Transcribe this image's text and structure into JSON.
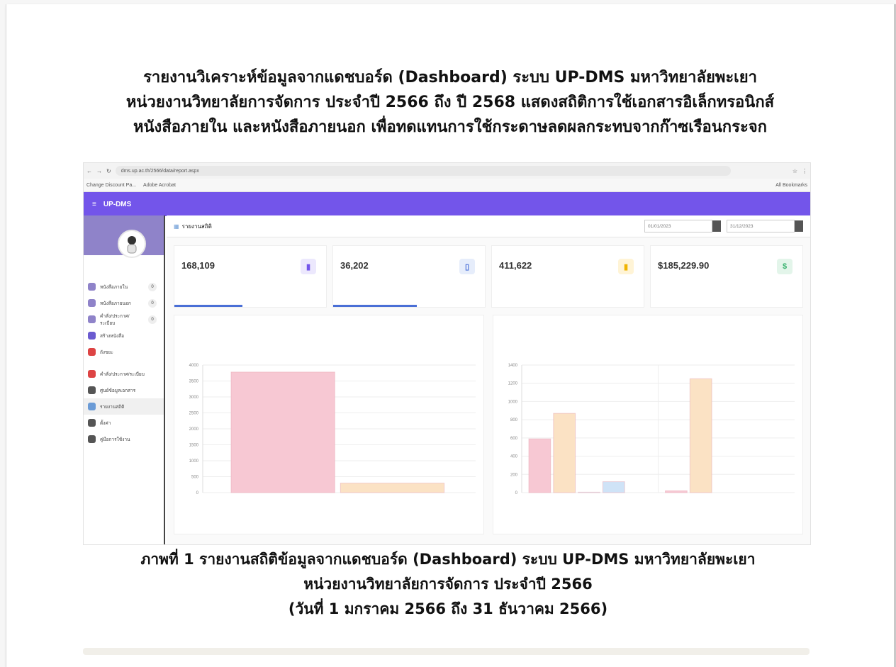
{
  "report": {
    "heading_lines": [
      "รายงานวิเคราะห์ข้อมูลจากแดชบอร์ด (Dashboard) ระบบ UP-DMS มหาวิทยาลัยพะเยา",
      "หน่วยงานวิทยาลัยการจัดการ ประจำปี 2566 ถึง ปี 2568 แสดงสถิติการใช้เอกสารอิเล็กทรอนิกส์",
      "หนังสือภายใน และหนังสือภายนอก เพื่อทดแทนการใช้กระดาษลดผลกระทบจากก๊าซเรือนกระจก"
    ],
    "caption_lines": [
      "ภาพที่ 1 รายงานสถิติข้อมูลจากแดชบอร์ด (Dashboard) ระบบ UP-DMS มหาวิทยาลัยพะเยา",
      "หน่วยงานวิทยาลัยการจัดการ ประจำปี 2566",
      "(วันที่ 1 มกราคม 2566 ถึง 31 ธันวาคม 2566)"
    ]
  },
  "browser": {
    "url": "dms.up.ac.th/2566/data/report.aspx",
    "bookmarks": [
      "Change Discount Pa...",
      "Adobe Acrobat"
    ],
    "all_bookmarks": "All Bookmarks"
  },
  "app": {
    "name": "UP-DMS",
    "page_title": "รายงานสถิติ",
    "date_from": "01/01/2023",
    "date_to": "31/12/2023",
    "sidebar": [
      "หนังสือภายใน",
      "หนังสือภายนอก",
      "คำสั่ง/ประกาศ/ระเบียบ",
      "สร้างหนังสือ",
      "ถังขยะ",
      "คำสั่ง/ประกาศ/ระเบียบ",
      "ศูนย์ข้อมูลเอกสาร",
      "รายงานสถิติ",
      "ตั้งค่า",
      "คู่มือการใช้งาน"
    ]
  },
  "cards": [
    {
      "value": "168,109",
      "color": "#7355ea",
      "icon": "document-icon",
      "bar": 0.45
    },
    {
      "value": "36,202",
      "color": "#4a6fd6",
      "icon": "file-icon",
      "bar": 0.55
    },
    {
      "value": "411,622",
      "color": "#f0b400",
      "icon": "folder-icon",
      "bar": 0
    },
    {
      "value": "$185,229.90",
      "color": "#3cb371",
      "icon": "dollar-icon",
      "bar": 0
    }
  ],
  "chart_data": [
    {
      "type": "bar",
      "ylim": [
        0,
        4000
      ],
      "yticks": [
        0,
        500,
        1000,
        1500,
        2000,
        2500,
        3000,
        3500,
        4000
      ],
      "series": [
        {
          "values": [
            3780
          ],
          "color": "#f7c8d3"
        },
        {
          "values": [
            300
          ],
          "color": "#fbe2c4"
        }
      ]
    },
    {
      "type": "bar",
      "ylim": [
        0,
        1400
      ],
      "yticks": [
        0,
        200,
        400,
        600,
        800,
        1000,
        1200,
        1400
      ],
      "groups": 2,
      "series": [
        {
          "values": [
            590,
            20
          ],
          "color": "#f7c8d3"
        },
        {
          "values": [
            870,
            1250
          ],
          "color": "#fbe2c4"
        },
        {
          "values": [
            5,
            0
          ],
          "color": "#c9e6f5"
        },
        {
          "values": [
            120,
            0
          ],
          "color": "#cfe3f7"
        }
      ]
    }
  ]
}
